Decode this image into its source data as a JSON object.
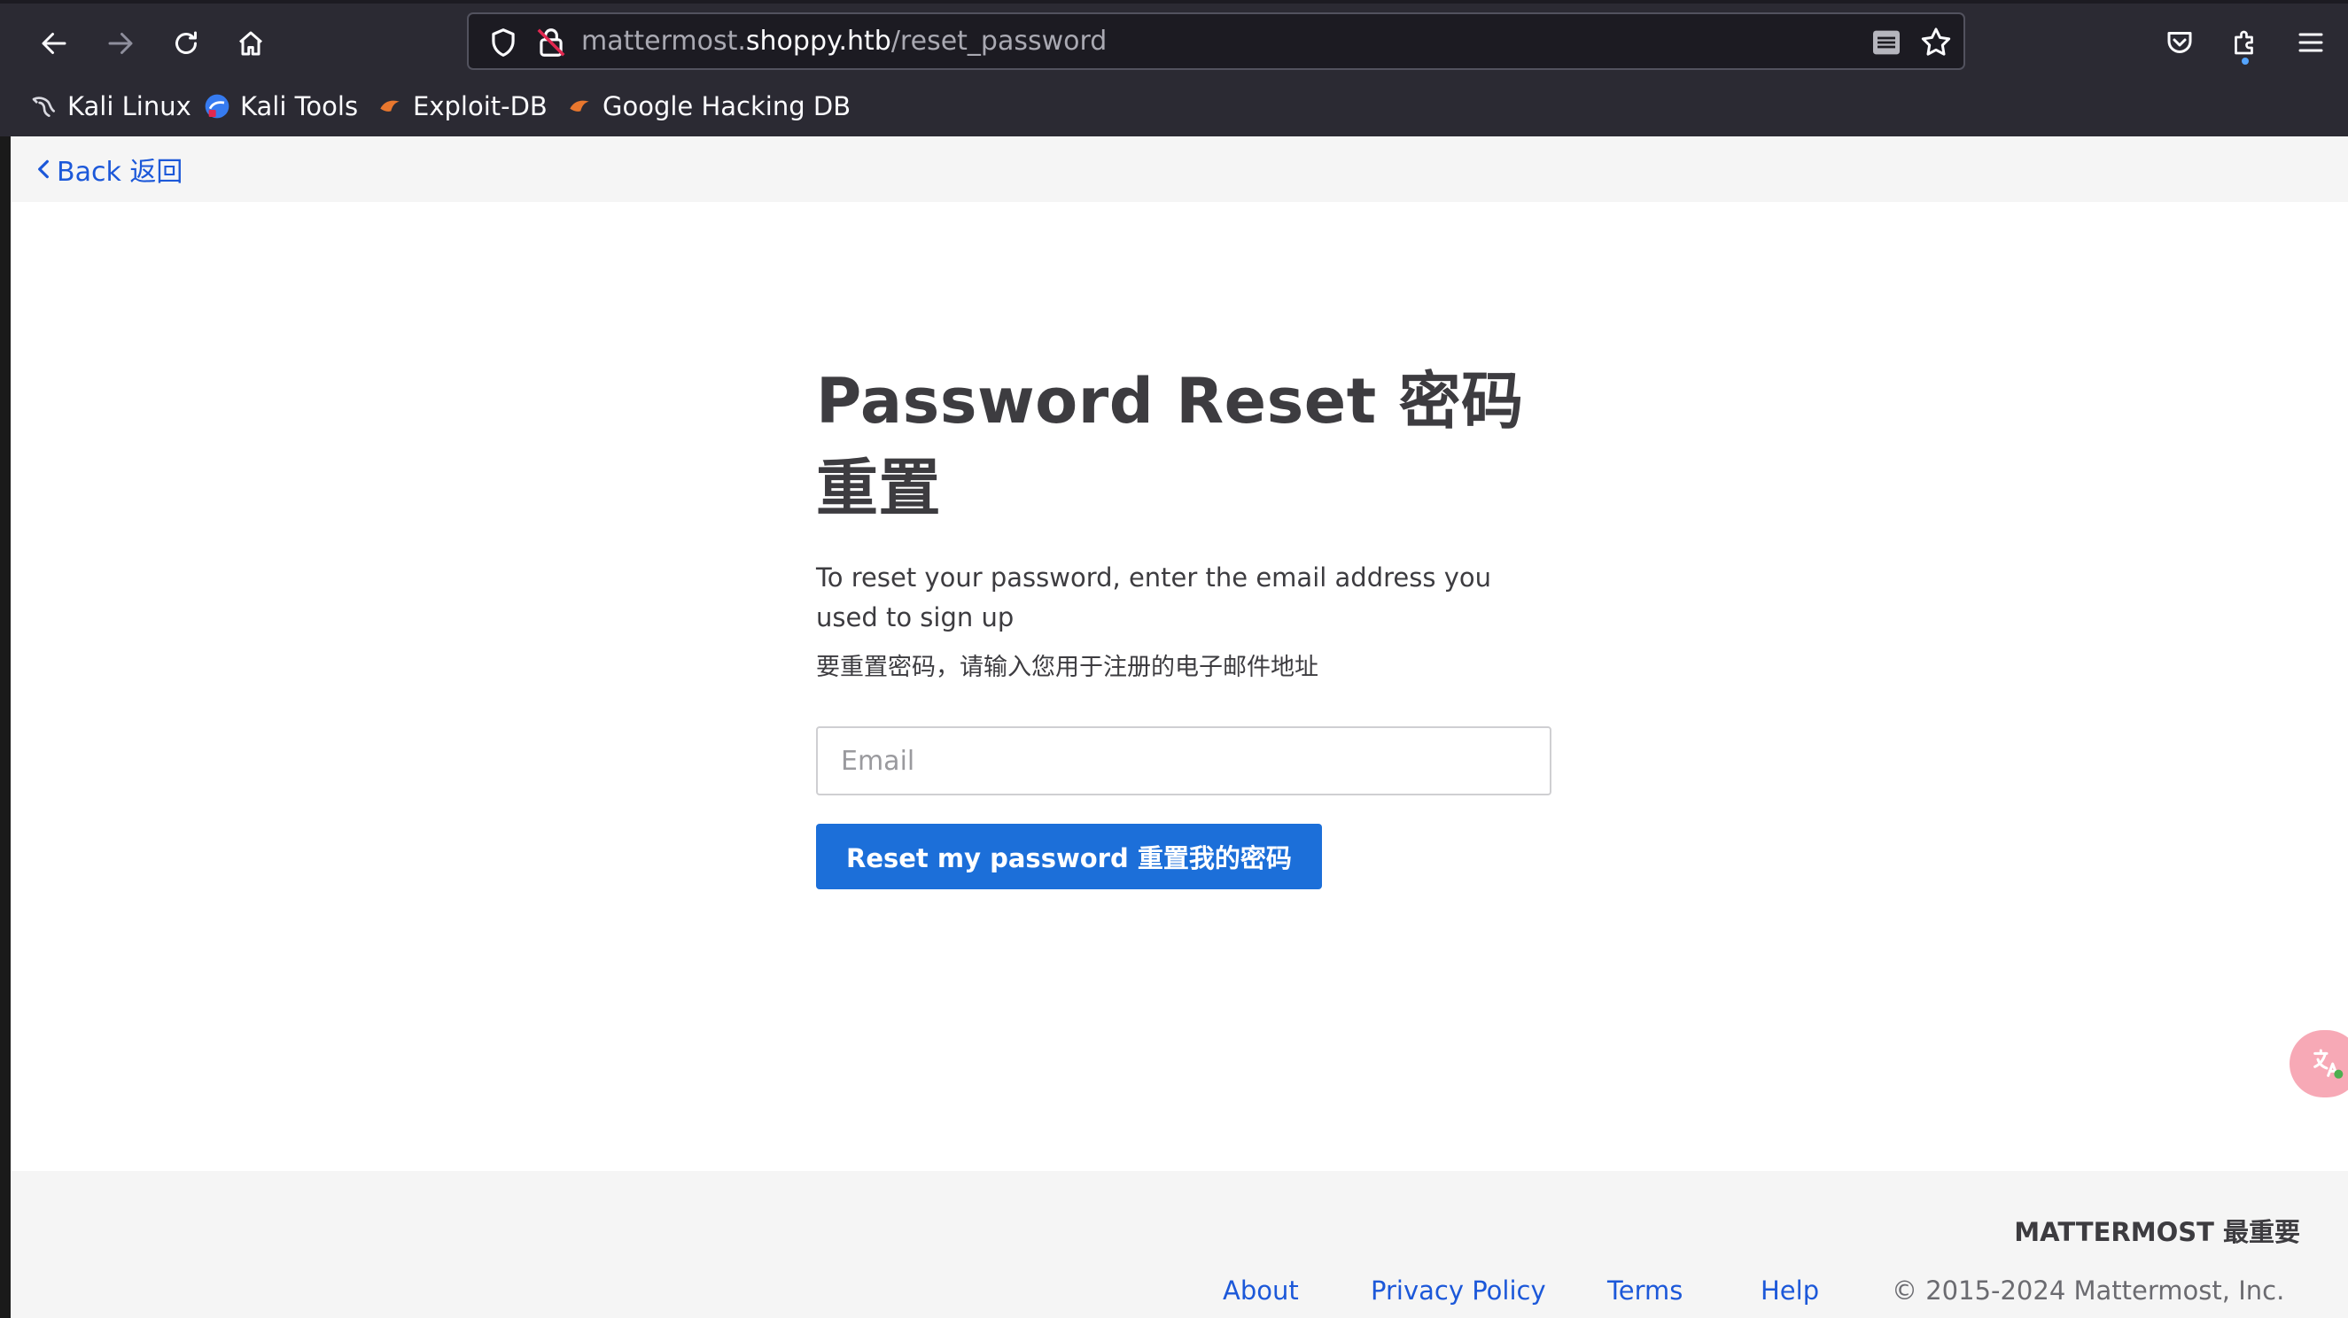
{
  "browser": {
    "url_prefix": "mattermost.",
    "url_host": "shoppy.htb",
    "url_path": "/reset_password",
    "bookmarks": [
      {
        "label": "Kali Linux",
        "icon": "kali-dragon-icon"
      },
      {
        "label": "Kali Tools",
        "icon": "kali-tools-icon"
      },
      {
        "label": "Exploit-DB",
        "icon": "exploit-db-icon"
      },
      {
        "label": "Google Hacking DB",
        "icon": "ghdb-icon"
      }
    ]
  },
  "page": {
    "back_label": "Back 返回",
    "title": "Password Reset 密码重置",
    "subtitle": "To reset your password, enter the email address you used to sign up",
    "subtitle_cn": "要重置密码，请输入您用于注册的电子邮件地址",
    "email_placeholder": "Email",
    "reset_button": "Reset my password 重置我的密码"
  },
  "footer": {
    "brand": "MATTERMOST 最重要",
    "links": [
      "About",
      "Privacy Policy",
      "Terms",
      "Help"
    ],
    "copyright": "© 2015-2024 Mattermost, Inc."
  },
  "colors": {
    "chrome_bg": "#2b2a33",
    "link": "#1c58d9",
    "button_bg": "#1c6fd9",
    "text": "#3d3c40"
  }
}
